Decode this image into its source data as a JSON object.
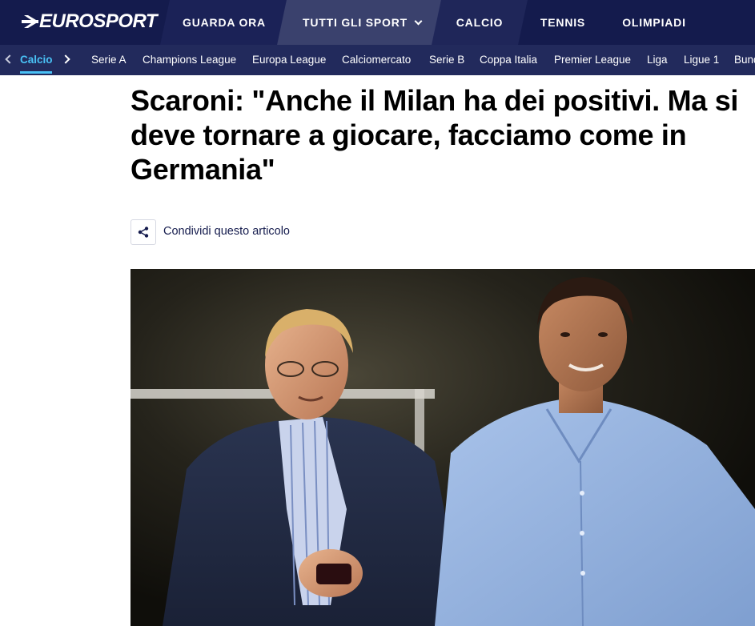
{
  "brand": {
    "name": "EUROSPORT"
  },
  "topnav": {
    "items": [
      {
        "label": "GUARDA ORA"
      },
      {
        "label": "TUTTI GLI SPORT"
      },
      {
        "label": "CALCIO"
      },
      {
        "label": "TENNIS"
      },
      {
        "label": "OLIMPIADI"
      }
    ]
  },
  "subnav": {
    "active": "Calcio",
    "items": [
      "Serie A",
      "Champions League",
      "Europa League",
      "Calciomercato",
      "Serie B",
      "Coppa Italia",
      "Premier League",
      "Liga",
      "Ligue 1",
      "Bund"
    ]
  },
  "article": {
    "title": "Scaroni: \"Anche il Milan ha dei positivi. Ma si deve tornare a giocare, facciamo come in Germania\"",
    "share_label": "Condividi questo articolo"
  },
  "colors": {
    "nav_bg": "#141b4d",
    "subnav_bg": "#222a5c",
    "accent": "#49c1f5"
  },
  "icons": [
    "share-icon",
    "chevron-left-icon",
    "chevron-right-icon",
    "chevron-down-icon"
  ]
}
